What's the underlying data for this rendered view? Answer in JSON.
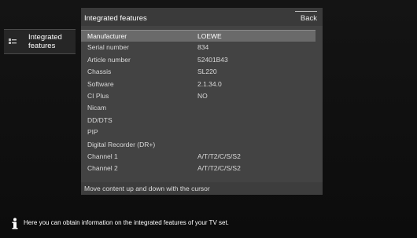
{
  "sidebar": {
    "item_label": "Integrated features"
  },
  "panel": {
    "title": "Integrated features",
    "back_label": "Back",
    "rows": [
      {
        "key": "Manufacturer",
        "value": "LOEWE"
      },
      {
        "key": "Serial number",
        "value": "834"
      },
      {
        "key": "Article number",
        "value": "52401B43"
      },
      {
        "key": "Chassis",
        "value": "SL220"
      },
      {
        "key": "Software",
        "value": "2.1.34.0"
      },
      {
        "key": "CI Plus",
        "value": "NO"
      },
      {
        "key": "Nicam",
        "value": ""
      },
      {
        "key": "DD/DTS",
        "value": ""
      },
      {
        "key": "PIP",
        "value": ""
      },
      {
        "key": "Digital Recorder (DR+)",
        "value": ""
      },
      {
        "key": "Channel 1",
        "value": "A/T/T2/C/S/S2"
      },
      {
        "key": "Channel 2",
        "value": "A/T/T2/C/S/S2"
      }
    ],
    "hint": "Move content up and down with the cursor"
  },
  "info": {
    "text": "Here you can obtain information on the integrated features of your TV set.",
    "icon": "info-icon"
  },
  "colors": {
    "background": "#0e0e0e",
    "panel": "#434343",
    "selected_row": "#6a6a6a"
  }
}
